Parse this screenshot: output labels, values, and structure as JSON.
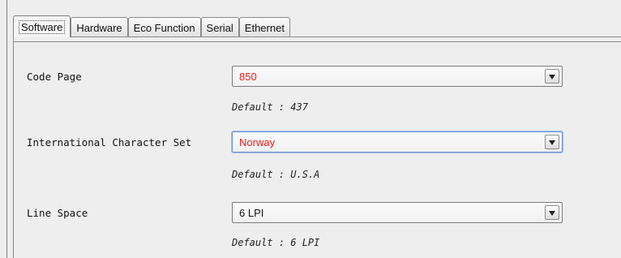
{
  "tabs": [
    {
      "label": "Software",
      "active": true
    },
    {
      "label": "Hardware"
    },
    {
      "label": "Eco Function"
    },
    {
      "label": "Serial"
    },
    {
      "label": "Ethernet"
    }
  ],
  "settings": {
    "code_page": {
      "label": "Code Page",
      "value": "850",
      "default": "Default : 437"
    },
    "intl_charset": {
      "label": "International Character Set",
      "value": "Norway",
      "default": "Default : U.S.A"
    },
    "line_space": {
      "label": "Line Space",
      "value": "6 LPI",
      "default": "Default : 6 LPI"
    }
  },
  "colors": {
    "changed_value": "#e02020",
    "focus_border": "#6a8fcb"
  }
}
